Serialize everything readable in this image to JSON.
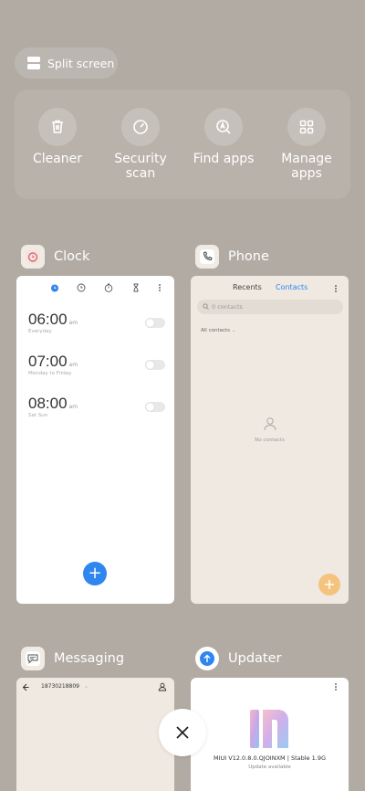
{
  "split_screen": {
    "label": "Split screen"
  },
  "tools": [
    {
      "label": "Cleaner",
      "icon": "trash-icon"
    },
    {
      "label": "Security\nscan",
      "icon": "security-icon"
    },
    {
      "label": "Find apps",
      "icon": "find-apps-icon"
    },
    {
      "label": "Manage\napps",
      "icon": "grid-icon"
    }
  ],
  "apps": {
    "clock": {
      "name": "Clock",
      "alarms": [
        {
          "time": "06:00",
          "ampm": "am",
          "repeat": "Everyday"
        },
        {
          "time": "07:00",
          "ampm": "am",
          "repeat": "Monday to Friday"
        },
        {
          "time": "08:00",
          "ampm": "am",
          "repeat": "Sat Sun"
        }
      ],
      "fab": "+"
    },
    "phone": {
      "name": "Phone",
      "tab_recents": "Recents",
      "tab_contacts": "Contacts",
      "search_placeholder": "0 contacts",
      "filter": "All contacts",
      "empty_text": "No contacts",
      "fab": "+"
    },
    "messaging": {
      "name": "Messaging",
      "number": "18730218809"
    },
    "updater": {
      "name": "Updater",
      "version": "MIUI V12.0.8.0.QJOINXM | Stable 1.9G",
      "status": "Update available"
    }
  },
  "close": {
    "icon": "close-icon"
  },
  "colors": {
    "background": "#b2aba3",
    "accent_blue": "#2f86ef",
    "phone_fab": "#f4c47f"
  }
}
